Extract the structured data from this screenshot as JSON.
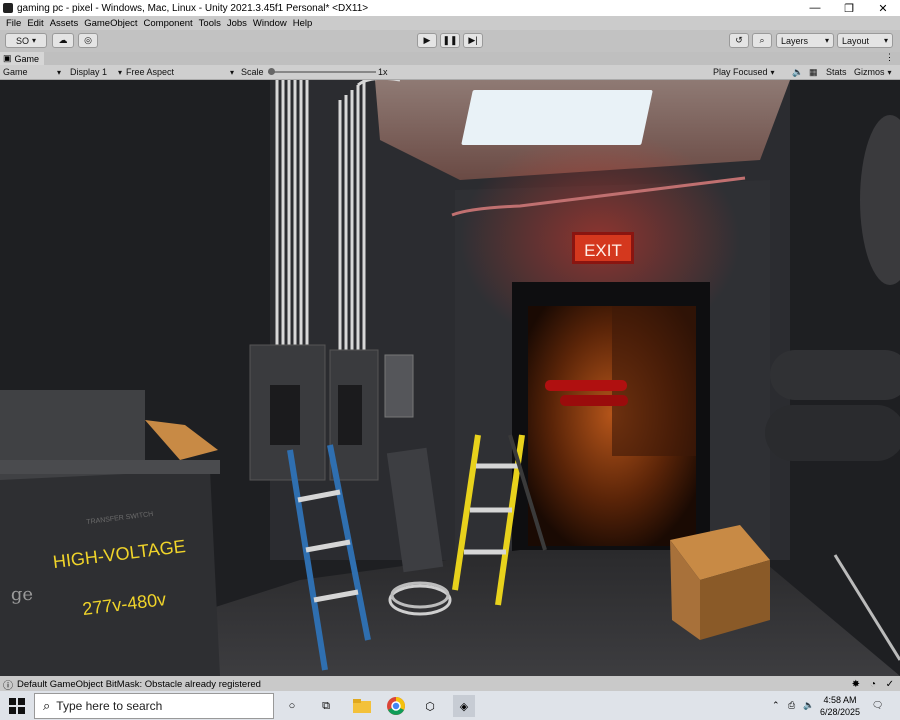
{
  "window": {
    "title": "gaming pc - pixel - Windows, Mac, Linux - Unity 2021.3.45f1 Personal* <DX11>",
    "minimize": "—",
    "maximize": "❐",
    "close": "✕"
  },
  "menu": [
    "File",
    "Edit",
    "Assets",
    "GameObject",
    "Component",
    "Tools",
    "Jobs",
    "Window",
    "Help"
  ],
  "toolbar": {
    "account": "SO",
    "layers": "Layers",
    "layout": "Layout"
  },
  "game_tab": {
    "label": "Game"
  },
  "game_bar": {
    "mode": "Game",
    "display": "Display 1",
    "aspect": "Free Aspect",
    "scale_label": "Scale",
    "scale_value": "1x",
    "play_focused": "Play Focused",
    "stats": "Stats",
    "gizmos": "Gizmos"
  },
  "scene": {
    "exit_sign": "EXIT",
    "transfer_switch": "TRANSFER SWITCH",
    "high_voltage": "HIGH-VOLTAGE",
    "voltage": "277v-480v",
    "logo": "ge"
  },
  "status": {
    "message": "Default GameObject BitMask: Obstacle already registered"
  },
  "taskbar": {
    "search_placeholder": "Type here to search",
    "time": "4:58 AM",
    "date": "6/28/2025"
  },
  "colors": {
    "exit_red": "#d4381e",
    "ladder_blue": "#2f6fb0",
    "ladder_yellow": "#e8d21c",
    "box_orange": "#c88a45"
  }
}
